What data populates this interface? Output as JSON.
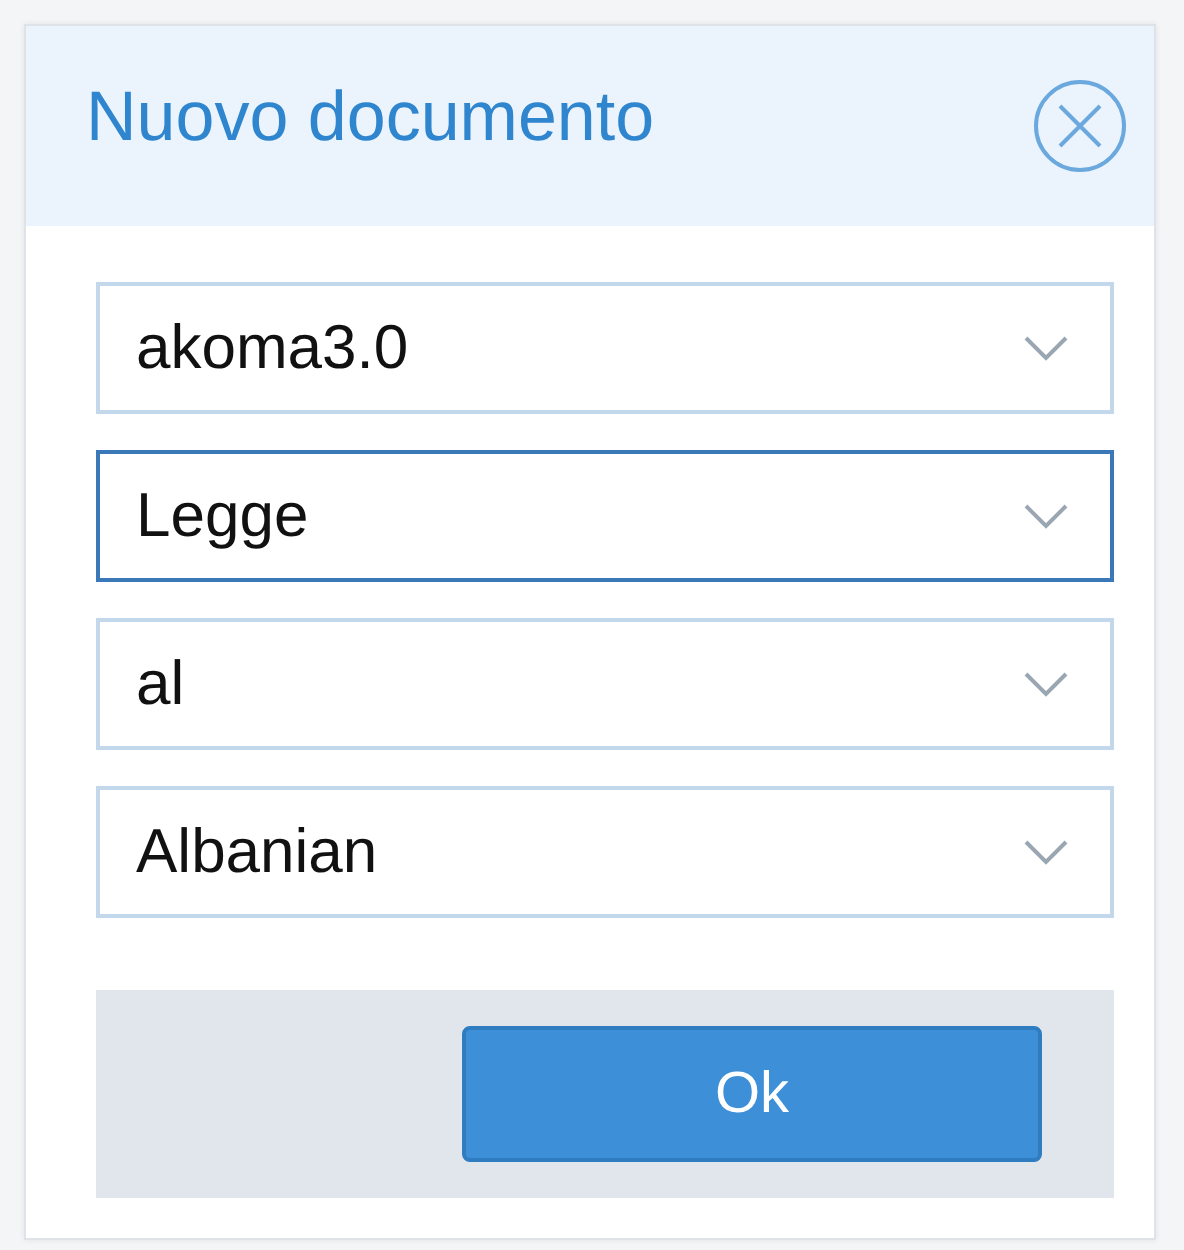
{
  "dialog": {
    "title": "Nuovo documento",
    "selects": [
      {
        "value": "akoma3.0",
        "focused": false
      },
      {
        "value": "Legge",
        "focused": true
      },
      {
        "value": "al",
        "focused": false
      },
      {
        "value": "Albanian",
        "focused": false
      }
    ],
    "buttons": [
      "Ok"
    ]
  }
}
